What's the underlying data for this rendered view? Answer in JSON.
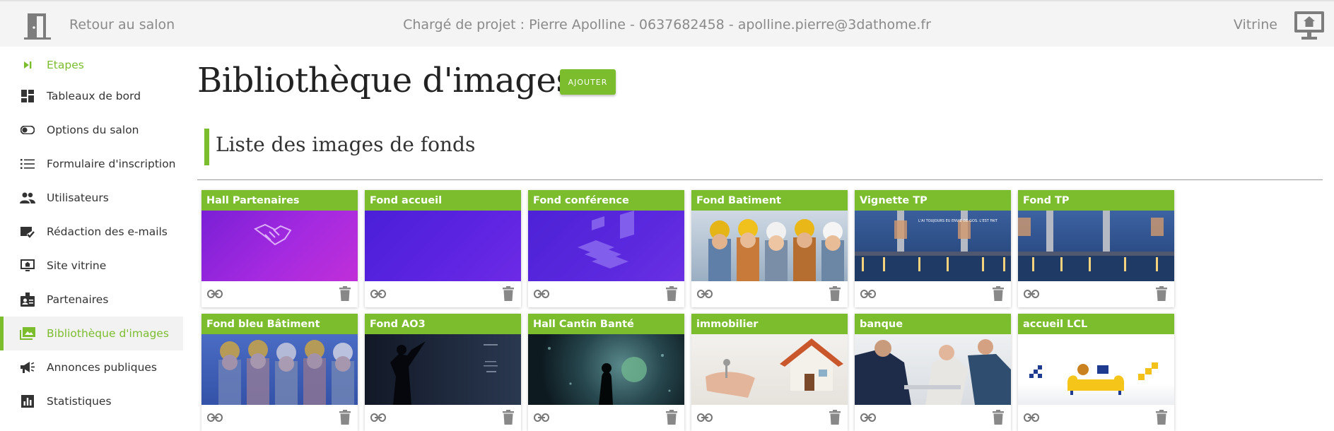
{
  "header": {
    "back_label": "Retour au salon",
    "contact": "Chargé de projet : Pierre Apolline - 0637682458 - apolline.pierre@3dathome.fr",
    "vitrine_label": "Vitrine"
  },
  "sidebar": {
    "items": [
      {
        "label": "Etapes",
        "icon": "skip-next-icon"
      },
      {
        "label": "Tableaux de bord",
        "icon": "dashboard-icon"
      },
      {
        "label": "Options du salon",
        "icon": "toggle-icon"
      },
      {
        "label": "Formulaire d'inscription",
        "icon": "list-icon"
      },
      {
        "label": "Utilisateurs",
        "icon": "people-icon"
      },
      {
        "label": "Rédaction des e-mails",
        "icon": "mail-check-icon"
      },
      {
        "label": "Site vitrine",
        "icon": "monitor-icon"
      },
      {
        "label": "Partenaires",
        "icon": "badge-icon"
      },
      {
        "label": "Bibliothèque d'images",
        "icon": "photo-library-icon",
        "active": true
      },
      {
        "label": "Annonces publiques",
        "icon": "megaphone-icon"
      },
      {
        "label": "Statistiques",
        "icon": "bar-chart-icon"
      }
    ]
  },
  "main": {
    "title": "Bibliothèque d'images",
    "add_label": "AJOUTER",
    "section_title": "Liste des images de fonds"
  },
  "cards": [
    {
      "title": "Hall Partenaires"
    },
    {
      "title": "Fond accueil"
    },
    {
      "title": "Fond conférence"
    },
    {
      "title": "Fond Batiment"
    },
    {
      "title": "Vignette TP"
    },
    {
      "title": "Fond TP"
    },
    {
      "title": "Fond bleu Bâtiment"
    },
    {
      "title": "Fond AO3"
    },
    {
      "title": "Hall Cantin Banté"
    },
    {
      "title": "immobilier"
    },
    {
      "title": "banque"
    },
    {
      "title": "accueil LCL"
    }
  ],
  "thumb_texts": {
    "vignette_caption": "L'AI TOUJOURS EU ENVIE DE GOS. L'EST FAIT"
  },
  "colors": {
    "accent": "#7cbd2e",
    "topbar_bg": "#f4f4f4",
    "active_bg": "#f2f2f2"
  }
}
